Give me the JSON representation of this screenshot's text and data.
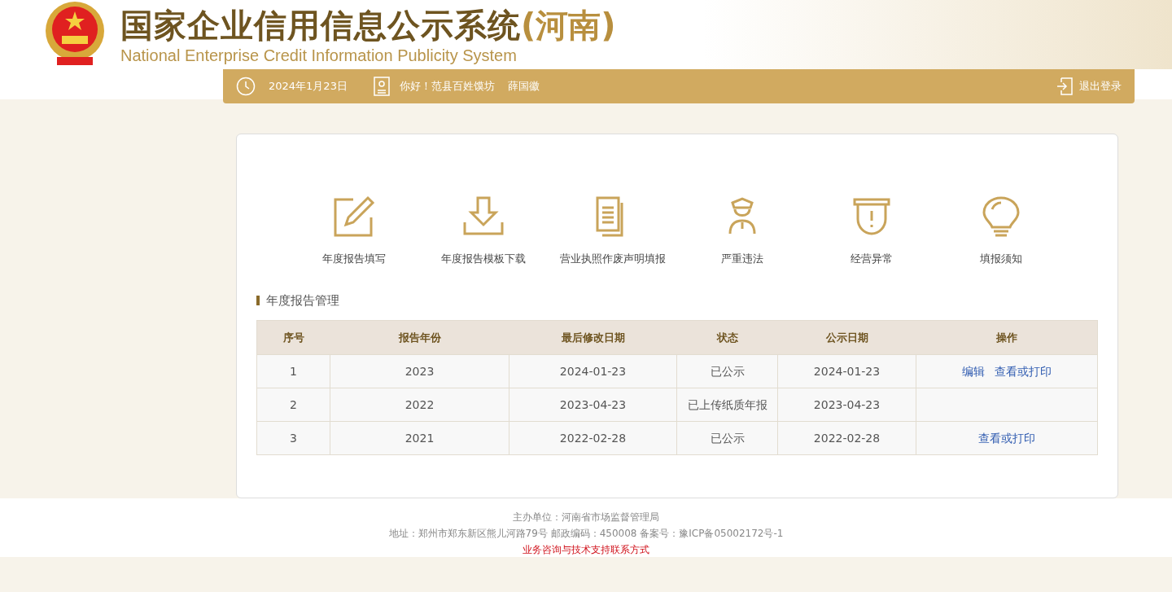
{
  "header": {
    "title": "国家企业信用信息公示系统",
    "region": "(河南)",
    "subtitle": "National Enterprise Credit Information Publicity System"
  },
  "user_bar": {
    "date": "2024年1月23日",
    "greeting": "你好！范县百姓馍坊",
    "user": "薛国徽",
    "logout": "退出登录"
  },
  "tools": [
    {
      "kind": "edit",
      "label": "年度报告填写"
    },
    {
      "kind": "download",
      "label": "年度报告模板下载"
    },
    {
      "kind": "document",
      "label": "营业执照作废声明填报"
    },
    {
      "kind": "officer",
      "label": "严重违法"
    },
    {
      "kind": "warning",
      "label": "经营异常"
    },
    {
      "kind": "bulb",
      "label": "填报须知"
    }
  ],
  "section": {
    "title": "年度报告管理"
  },
  "table": {
    "columns": [
      "序号",
      "报告年份",
      "最后修改日期",
      "状态",
      "公示日期",
      "操作"
    ],
    "rows": [
      {
        "cells": [
          "1",
          "2023",
          "2024-01-23",
          "已公示",
          "2024-01-23"
        ],
        "actions": [
          "编辑",
          "查看或打印"
        ]
      },
      {
        "cells": [
          "2",
          "2022",
          "2023-04-23",
          "已上传纸质年报",
          "2023-04-23"
        ],
        "actions": []
      },
      {
        "cells": [
          "3",
          "2021",
          "2022-02-28",
          "已公示",
          "2022-02-28"
        ],
        "actions": [
          "查看或打印"
        ]
      }
    ]
  },
  "footer": {
    "sponsor": "主办单位：河南省市场监督管理局",
    "address": "地址：郑州市郑东新区熊儿河路79号 邮政编码：450008 备案号：豫ICP备05002172号-1",
    "contact": "业务咨询与技术支持联系方式"
  }
}
